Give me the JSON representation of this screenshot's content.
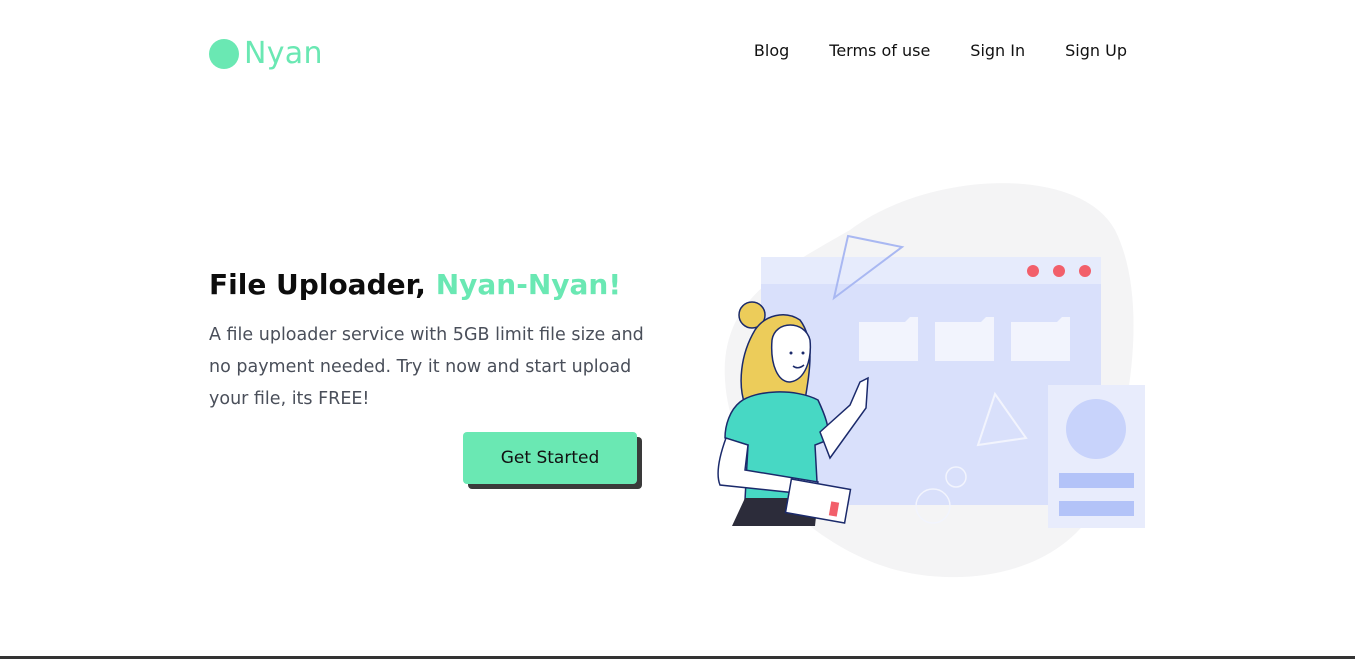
{
  "brand": {
    "name": "Nyan",
    "color": "#6ae8b3"
  },
  "nav": {
    "blog": "Blog",
    "terms": "Terms of use",
    "signin": "Sign In",
    "signup": "Sign Up"
  },
  "hero": {
    "title_main": "File Uploader, ",
    "title_accent": "Nyan-Nyan!",
    "description": "A file uploader service with 5GB limit file size and no payment needed. Try it now and start upload your file, its FREE!",
    "cta_label": "Get Started"
  },
  "illustration": {
    "icon": "person-uploading-file-illustration"
  }
}
